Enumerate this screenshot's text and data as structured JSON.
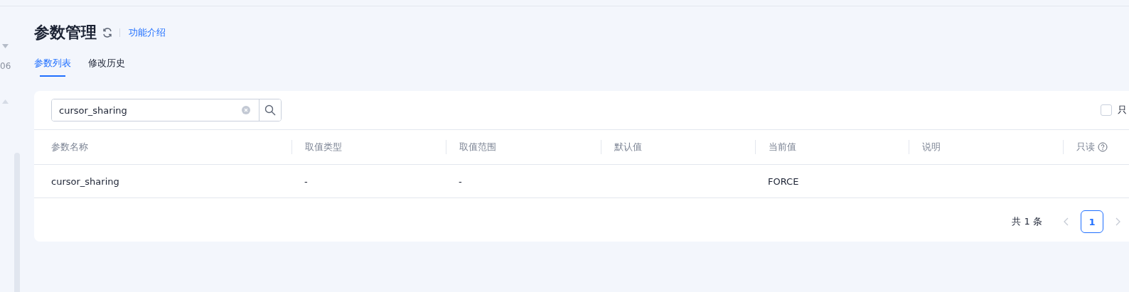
{
  "sidebar": {
    "value_text": "06"
  },
  "header": {
    "title": "参数管理",
    "link": "功能介绍"
  },
  "tabs": [
    {
      "label": "参数列表",
      "selected": true
    },
    {
      "label": "修改历史",
      "selected": false
    }
  ],
  "search": {
    "value": "cursor_sharing"
  },
  "filter": {
    "label": "只",
    "checked": false
  },
  "table": {
    "columns": [
      {
        "label": "参数名称",
        "help": false
      },
      {
        "label": "取值类型",
        "help": false
      },
      {
        "label": "取值范围",
        "help": false
      },
      {
        "label": "默认值",
        "help": false
      },
      {
        "label": "当前值",
        "help": false
      },
      {
        "label": "说明",
        "help": false
      },
      {
        "label": "只读",
        "help": true
      }
    ],
    "rows": [
      [
        "cursor_sharing",
        "-",
        "-",
        "",
        "FORCE",
        "",
        ""
      ]
    ]
  },
  "pagination": {
    "total": "共 1 条",
    "pages": [
      {
        "label": "1",
        "selected": true
      }
    ]
  }
}
